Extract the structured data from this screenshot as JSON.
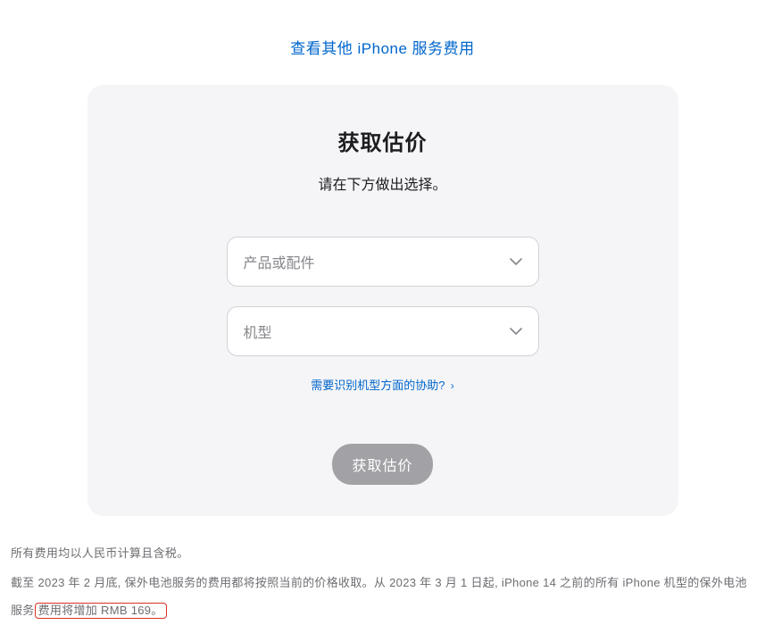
{
  "topLink": {
    "label": "查看其他 iPhone 服务费用"
  },
  "card": {
    "title": "获取估价",
    "subtitle": "请在下方做出选择。",
    "select1": {
      "placeholder": "产品或配件"
    },
    "select2": {
      "placeholder": "机型"
    },
    "helpLink": {
      "label": "需要识别机型方面的协助?"
    },
    "button": {
      "label": "获取估价"
    }
  },
  "footer": {
    "line1": "所有费用均以人民币计算且含税。",
    "line2_part1": "截至 2023 年 2 月底, 保外电池服务的费用都将按照当前的价格收取。从 2023 年 3 月 1 日起, iPhone 14 之前的所有 iPhone 机型的保外电池服务",
    "line2_highlight": "费用将增加 RMB 169。"
  }
}
